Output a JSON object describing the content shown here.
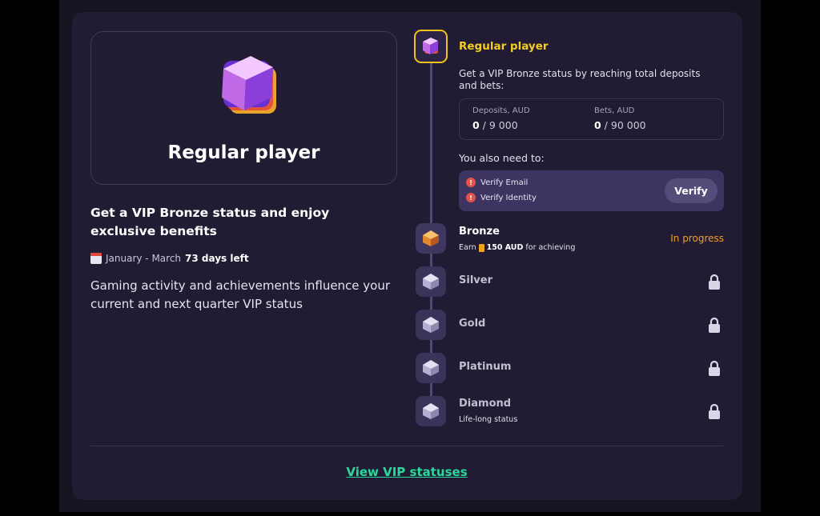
{
  "hero": {
    "title": "Regular player",
    "icon": "purple-cube-gem-icon"
  },
  "left": {
    "heading": "Get a VIP Bronze status and enjoy exclusive benefits",
    "period": "January - March",
    "days_left": "73 days left",
    "description": "Gaming activity and achievements influence your current and next quarter VIP status"
  },
  "current": {
    "title": "Regular player",
    "description": "Get a VIP Bronze status by reaching total deposits and bets:",
    "deposits_label": "Deposits, AUD",
    "deposits_value": "0",
    "deposits_target": " / 9 000",
    "bets_label": "Bets, AUD",
    "bets_value": "0",
    "bets_target": " / 90 000",
    "need_label": "You also need to:",
    "verify_email": "Verify Email",
    "verify_identity": "Verify Identity",
    "verify_button": "Verify"
  },
  "tiers": [
    {
      "name": "Bronze",
      "sub_prefix": "Earn",
      "sub_amount": "150 AUD",
      "sub_suffix": "for achieving",
      "status": "In progress"
    },
    {
      "name": "Silver"
    },
    {
      "name": "Gold"
    },
    {
      "name": "Platinum"
    },
    {
      "name": "Diamond",
      "sub": "Life-long status"
    }
  ],
  "footer": {
    "link": "View VIP statuses"
  },
  "colors": {
    "accent_yellow": "#f3cd22",
    "in_progress": "#f0a028",
    "link_green": "#2bd89c",
    "card_bg": "#211c33"
  }
}
